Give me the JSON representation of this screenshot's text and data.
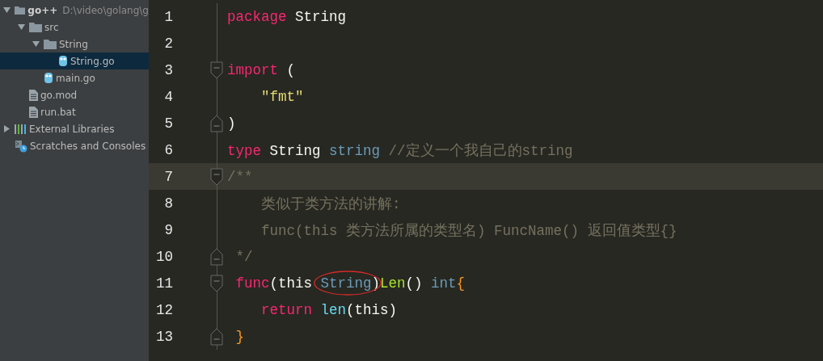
{
  "project_tree": [
    {
      "label": "go++",
      "path": "D:\\video\\golang\\g",
      "kind": "folder",
      "expanded": true,
      "selected": false,
      "children": [
        {
          "label": "src",
          "kind": "folder",
          "expanded": true,
          "selected": false,
          "children": [
            {
              "label": "String",
              "kind": "folder",
              "expanded": true,
              "selected": false,
              "children": [
                {
                  "label": "String.go",
                  "kind": "go",
                  "selected": true
                }
              ]
            },
            {
              "label": "main.go",
              "kind": "go",
              "selected": false
            }
          ]
        },
        {
          "label": "go.mod",
          "kind": "file",
          "selected": false
        },
        {
          "label": "run.bat",
          "kind": "file",
          "selected": false
        }
      ]
    },
    {
      "label": "External Libraries",
      "kind": "libraries",
      "expanded": false,
      "selected": false
    },
    {
      "label": "Scratches and Consoles",
      "kind": "scratches",
      "selected": false
    }
  ],
  "editor": {
    "lines": [
      {
        "number": "1",
        "fold_start": false,
        "fold_end": false,
        "current": false,
        "tokens": [
          {
            "kind": "keyword",
            "text": "package"
          },
          {
            "kind": "plain",
            "text": " String"
          }
        ]
      },
      {
        "number": "2",
        "fold_start": false,
        "fold_end": false,
        "current": false
      },
      {
        "number": "3",
        "fold_start": true,
        "fold_end": false,
        "current": false,
        "tokens": [
          {
            "kind": "keyword",
            "text": "import"
          },
          {
            "kind": "plain",
            "text": " ("
          }
        ]
      },
      {
        "number": "4",
        "fold_start": false,
        "fold_end": false,
        "current": false,
        "tokens": [
          {
            "kind": "string",
            "text": "    \"fmt\""
          }
        ]
      },
      {
        "number": "5",
        "fold_start": false,
        "fold_end": true,
        "current": false,
        "tokens": [
          {
            "kind": "plain",
            "text": ")"
          }
        ]
      },
      {
        "number": "6",
        "fold_start": false,
        "fold_end": false,
        "current": false,
        "tokens": [
          {
            "kind": "keyword",
            "text": "type"
          },
          {
            "kind": "plain",
            "text": " String "
          },
          {
            "kind": "type",
            "text": "string"
          },
          {
            "kind": "comment",
            "text": " //定义一个我自己的string"
          }
        ]
      },
      {
        "number": "7",
        "fold_start": true,
        "fold_end": false,
        "current": true,
        "tokens": [
          {
            "kind": "comment",
            "text": "/**"
          }
        ]
      },
      {
        "number": "8",
        "fold_start": false,
        "fold_end": false,
        "current": false,
        "tokens": [
          {
            "kind": "comment",
            "text": "    类似于类方法的讲解:"
          }
        ]
      },
      {
        "number": "9",
        "fold_start": false,
        "fold_end": false,
        "current": false,
        "tokens": [
          {
            "kind": "comment",
            "text": "    func(this 类方法所属的类型名) FuncName() 返回值类型{}"
          }
        ]
      },
      {
        "number": "10",
        "fold_start": false,
        "fold_end": true,
        "current": false,
        "tokens": [
          {
            "kind": "comment",
            "text": " */"
          }
        ]
      },
      {
        "number": "11",
        "fold_start": true,
        "fold_end": false,
        "current": false,
        "tokens": [
          {
            "kind": "keyword",
            "text": " func"
          },
          {
            "kind": "plain",
            "text": "(this "
          },
          {
            "kind": "type",
            "text": "String",
            "circled": true
          },
          {
            "kind": "plain",
            "text": ")"
          },
          {
            "kind": "function",
            "text": "Len"
          },
          {
            "kind": "plain",
            "text": "() "
          },
          {
            "kind": "type",
            "text": "int"
          },
          {
            "kind": "brace",
            "text": "{"
          }
        ]
      },
      {
        "number": "12",
        "fold_start": false,
        "fold_end": false,
        "current": false,
        "tokens": [
          {
            "kind": "keyword",
            "text": "    return "
          },
          {
            "kind": "builtin",
            "text": "len"
          },
          {
            "kind": "plain",
            "text": "(this)"
          }
        ]
      },
      {
        "number": "13",
        "fold_start": false,
        "fold_end": true,
        "current": false,
        "tokens": [
          {
            "kind": "brace",
            "text": " }"
          }
        ]
      }
    ]
  }
}
